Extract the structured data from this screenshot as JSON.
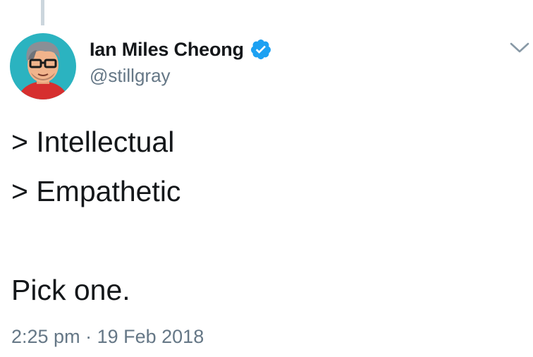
{
  "tweet": {
    "author": {
      "display_name": "Ian Miles Cheong",
      "handle": "@stillgray",
      "verified": true,
      "avatar": "cartoon-portrait-avatar"
    },
    "text_lines": [
      "> Intellectual",
      "> Empathetic",
      "",
      "Pick one."
    ],
    "time": "2:25 pm",
    "separator": "·",
    "date": "19 Feb 2018",
    "menu_icon": "chevron-down-icon"
  },
  "colors": {
    "verified_blue": "#1da1f2",
    "secondary_text": "#657786",
    "primary_text": "#14171a",
    "thread_line": "#ccd6dd"
  }
}
